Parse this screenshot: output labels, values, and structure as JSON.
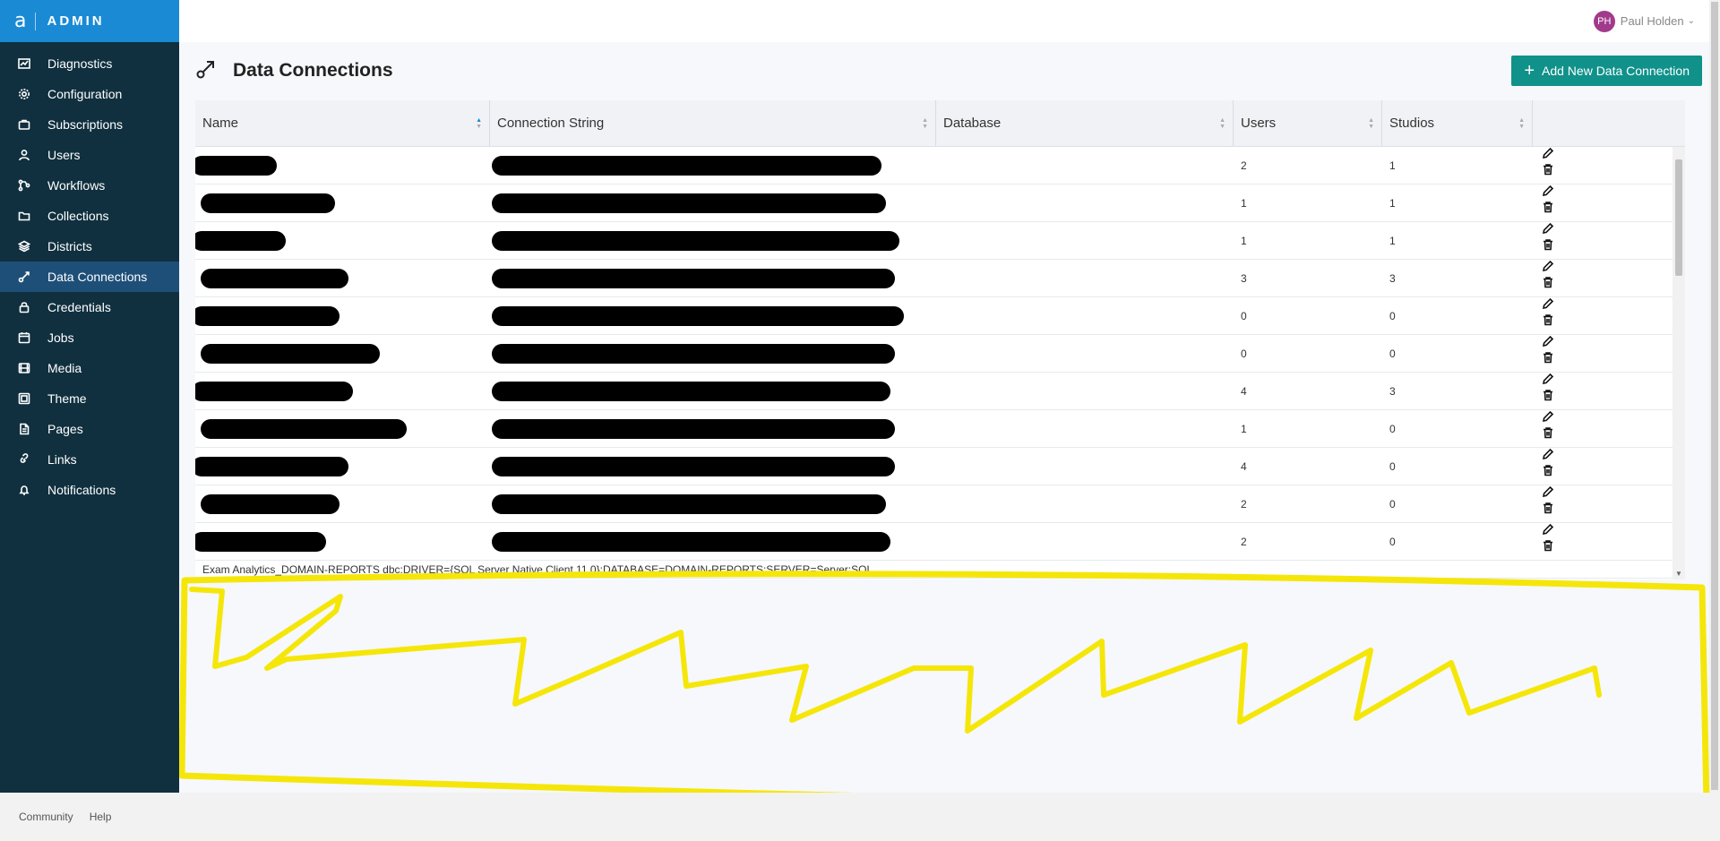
{
  "brand": {
    "logo": "a",
    "text": "ADMIN"
  },
  "sidebar": {
    "items": [
      {
        "label": "Diagnostics",
        "icon": "chart-icon"
      },
      {
        "label": "Configuration",
        "icon": "gear-icon"
      },
      {
        "label": "Subscriptions",
        "icon": "briefcase-icon"
      },
      {
        "label": "Users",
        "icon": "user-icon"
      },
      {
        "label": "Workflows",
        "icon": "workflow-icon"
      },
      {
        "label": "Collections",
        "icon": "folder-icon"
      },
      {
        "label": "Districts",
        "icon": "layers-icon"
      },
      {
        "label": "Data Connections",
        "icon": "connection-icon",
        "active": true
      },
      {
        "label": "Credentials",
        "icon": "lock-icon"
      },
      {
        "label": "Jobs",
        "icon": "calendar-icon"
      },
      {
        "label": "Media",
        "icon": "media-icon"
      },
      {
        "label": "Theme",
        "icon": "palette-icon"
      },
      {
        "label": "Pages",
        "icon": "page-icon"
      },
      {
        "label": "Links",
        "icon": "link-icon"
      },
      {
        "label": "Notifications",
        "icon": "bell-icon"
      }
    ]
  },
  "user": {
    "initials": "PH",
    "name": "Paul Holden",
    "avatar_color": "#a23a8c"
  },
  "page": {
    "title": "Data Connections",
    "add_button": "Add New Data Connection",
    "accent": "#10918a"
  },
  "table": {
    "columns": [
      "Name",
      "Connection String",
      "Database",
      "Users",
      "Studios"
    ],
    "rows": [
      {
        "users": "2",
        "studios": "1"
      },
      {
        "users": "1",
        "studios": "1"
      },
      {
        "users": "1",
        "studios": "1"
      },
      {
        "users": "3",
        "studios": "3"
      },
      {
        "users": "0",
        "studios": "0"
      },
      {
        "users": "0",
        "studios": "0"
      },
      {
        "users": "4",
        "studios": "3"
      },
      {
        "users": "1",
        "studios": "0"
      },
      {
        "users": "4",
        "studios": "0"
      },
      {
        "users": "2",
        "studios": "0"
      },
      {
        "users": "2",
        "studios": "0"
      }
    ],
    "partial_row_text": "Exam Analytics_DOMAIN-REPORTS       dbc:DRIVER={SQL Server Native Client 11.0};DATABASE=DOMAIN-REPORTS;SERVER=Server;SQL"
  },
  "footer": {
    "links": [
      "Community",
      "Help"
    ]
  },
  "annotation_color": "#f5e60a"
}
